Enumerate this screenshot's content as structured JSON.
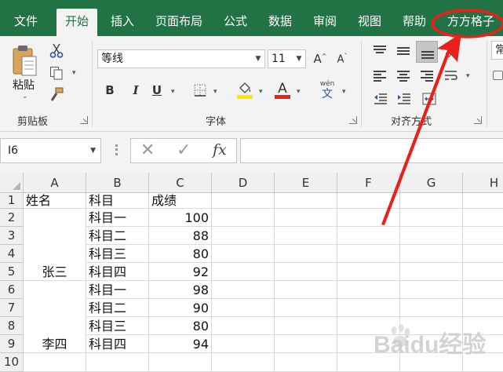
{
  "ribbon": {
    "tabs": [
      {
        "key": "file",
        "label": "文件"
      },
      {
        "key": "home",
        "label": "开始",
        "active": true
      },
      {
        "key": "insert",
        "label": "插入"
      },
      {
        "key": "layout",
        "label": "页面布局"
      },
      {
        "key": "formula",
        "label": "公式"
      },
      {
        "key": "data",
        "label": "数据"
      },
      {
        "key": "review",
        "label": "审阅"
      },
      {
        "key": "view",
        "label": "视图"
      },
      {
        "key": "help",
        "label": "帮助"
      },
      {
        "key": "ffcell",
        "label": "方方格子"
      }
    ],
    "clipboard": {
      "paste_label": "粘贴",
      "group_label": "剪贴板"
    },
    "font": {
      "font_name": "等线",
      "font_size": "11",
      "bold": "B",
      "italic": "I",
      "underline": "U",
      "group_label": "字体",
      "phonetic_top": "wén",
      "phonetic_bottom": "文"
    },
    "alignment": {
      "group_label": "对齐方式"
    },
    "number": {
      "format_partial": "常"
    }
  },
  "formula_bar": {
    "name_box": "I6",
    "fx_label": "fx",
    "value": ""
  },
  "grid": {
    "columns": [
      "A",
      "B",
      "C",
      "D",
      "E",
      "F",
      "G",
      "H"
    ],
    "rows": [
      "1",
      "2",
      "3",
      "4",
      "5",
      "6",
      "7",
      "8",
      "9",
      "10"
    ],
    "header": {
      "A": "姓名",
      "B": "科目",
      "C": "成绩"
    },
    "groups": [
      {
        "name": "张三",
        "span_rows": "2-5"
      },
      {
        "name": "李四",
        "span_rows": "6-9"
      }
    ],
    "records": [
      {
        "subject": "科目一",
        "score": "100"
      },
      {
        "subject": "科目二",
        "score": "88"
      },
      {
        "subject": "科目三",
        "score": "80"
      },
      {
        "subject": "科目四",
        "score": "92"
      },
      {
        "subject": "科目一",
        "score": "98"
      },
      {
        "subject": "科目二",
        "score": "90"
      },
      {
        "subject": "科目三",
        "score": "80"
      },
      {
        "subject": "科目四",
        "score": "94"
      }
    ]
  },
  "colors": {
    "ribbon_green": "#217346",
    "annotation_red": "#e8211a",
    "font_color_bar": "#e8211a",
    "fill_color_bar": "#ffe600"
  },
  "watermark": {
    "text": "Baidu经验",
    "icon": "baidu-paw-icon"
  }
}
